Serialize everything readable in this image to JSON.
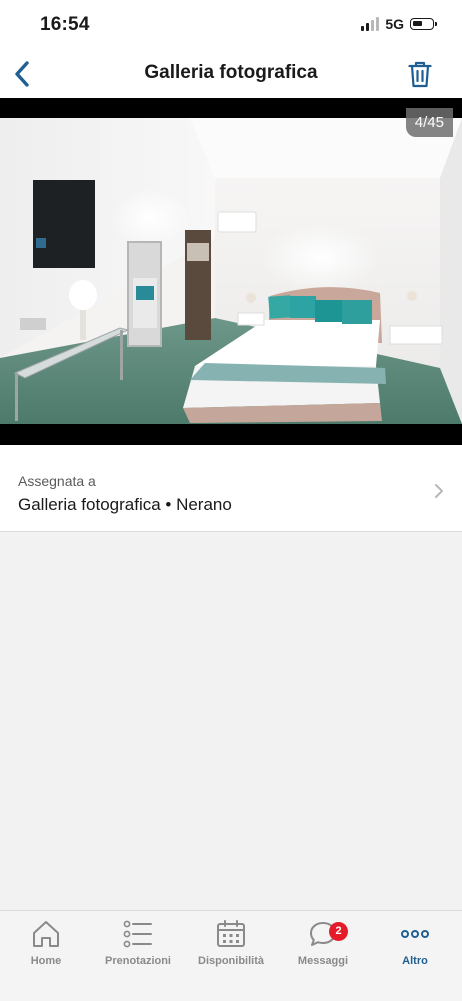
{
  "status_bar": {
    "time": "16:54",
    "network": "5G"
  },
  "header": {
    "title": "Galleria fotografica"
  },
  "photo": {
    "counter": "4/45"
  },
  "assigned": {
    "label": "Assegnata a",
    "value": "Galleria fotografica • Nerano"
  },
  "tabs": [
    {
      "label": "Home",
      "icon": "home-icon"
    },
    {
      "label": "Prenotazioni",
      "icon": "list-icon"
    },
    {
      "label": "Disponibilità",
      "icon": "calendar-icon"
    },
    {
      "label": "Messaggi",
      "icon": "chat-bubble-icon",
      "badge": "2"
    },
    {
      "label": "Altro",
      "icon": "more-dots-icon"
    }
  ],
  "colors": {
    "accent": "#1f5f93",
    "badge": "#e51b2a"
  }
}
